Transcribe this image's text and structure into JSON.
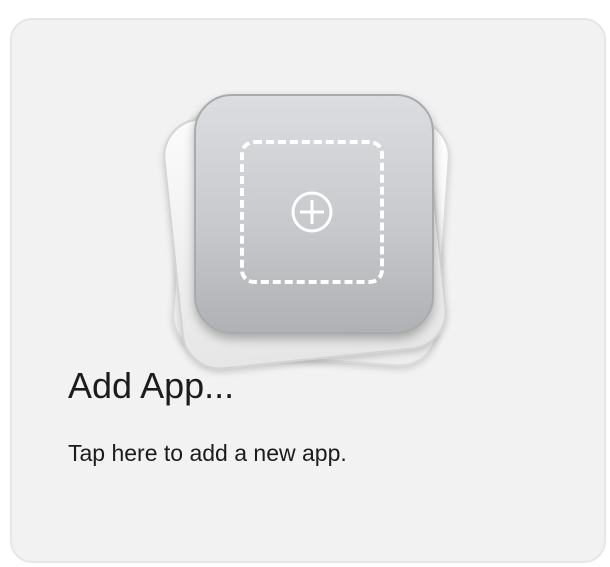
{
  "card": {
    "title": "Add App...",
    "subtitle": "Tap here to add a new app."
  },
  "icons": {
    "placeholder": "dashed-square-icon",
    "add": "plus-circle-icon"
  },
  "colors": {
    "card_background": "#f2f2f2",
    "tile_gradient_top": "#dcdde0",
    "tile_gradient_bottom": "#b0b1b4",
    "icon_stroke": "#ffffff",
    "text": "#1c1c1c"
  }
}
